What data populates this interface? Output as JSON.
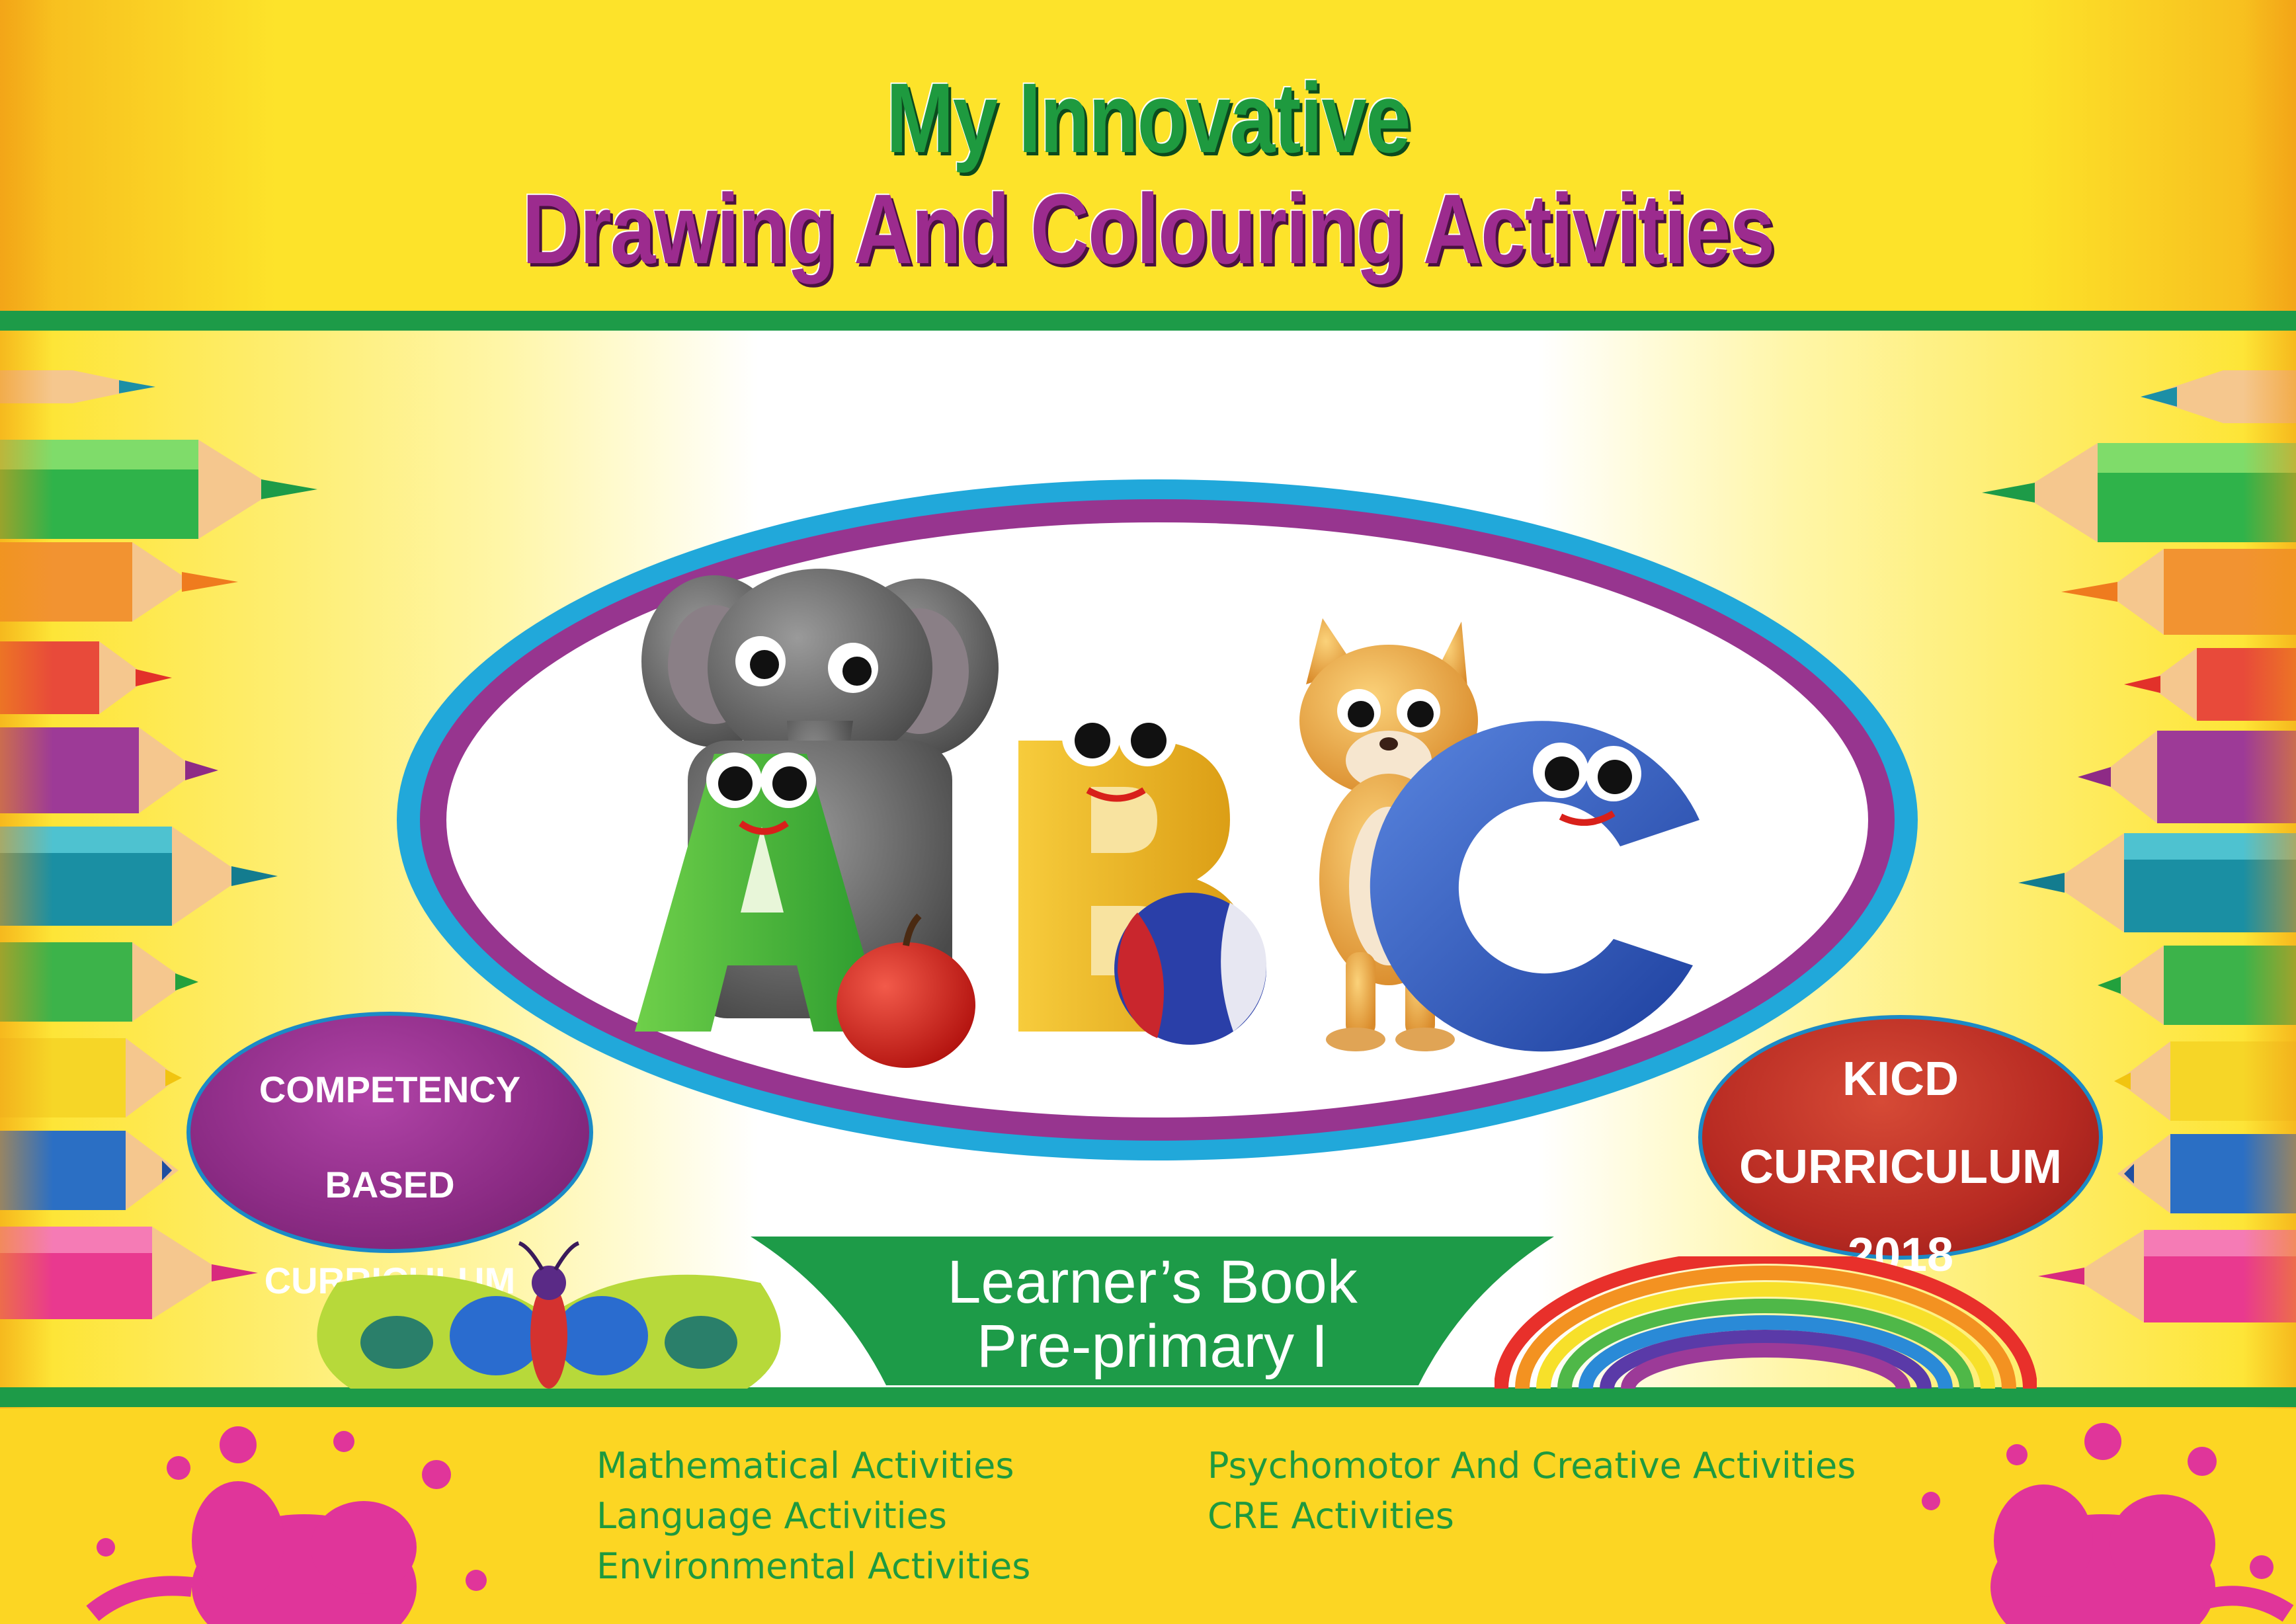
{
  "cover": {
    "title_line_1": "My Innovative",
    "title_line_2": "Drawing And Colouring Activities",
    "badge_left": [
      "COMPETENCY",
      "BASED",
      "CURRICULUM"
    ],
    "badge_right": [
      "KICD",
      "CURRICULUM",
      "2018"
    ],
    "book_type": "Learner’s Book",
    "level": "Pre-primary I"
  },
  "subjects": {
    "column_1": [
      "Mathematical Activities",
      "Language Activities",
      "Environmental Activities"
    ],
    "column_2": [
      "Psychomotor And Creative Activities",
      "CRE Activities"
    ]
  },
  "illustration": {
    "letters": [
      "A",
      "B",
      "C"
    ],
    "characters": [
      "elephant",
      "cat",
      "apple",
      "ball",
      "butterfly",
      "rainbow",
      "colour-pencils",
      "paint-splash"
    ]
  },
  "colors": {
    "background": "#fcd623",
    "title_green": "#1e9a3f",
    "title_purple": "#9c2b8e",
    "stripe_green": "#1d9b48",
    "oval_blue": "#21a8da",
    "oval_purple": "#97358f",
    "badge_purple": "#8b2b84",
    "badge_red": "#b72a22",
    "splash_pink": "#e0359a"
  }
}
